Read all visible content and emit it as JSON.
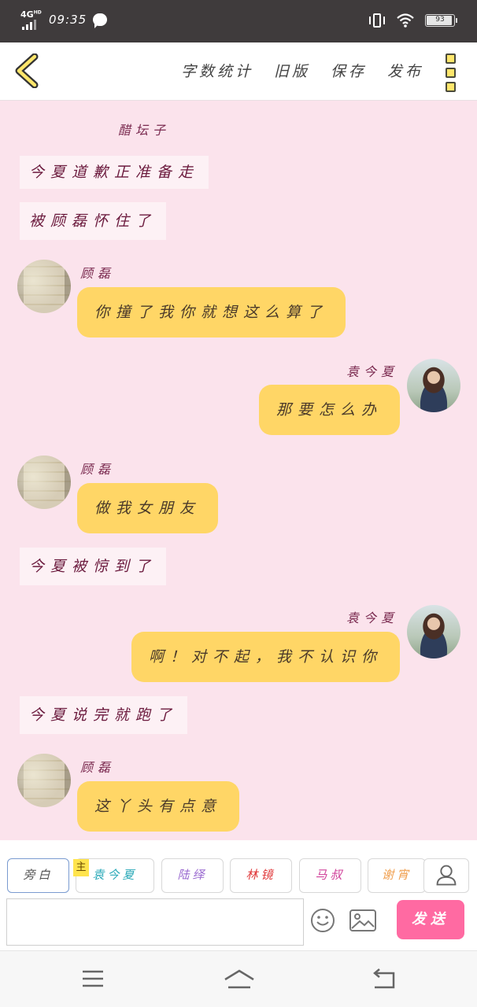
{
  "status": {
    "network": "4G",
    "network_sup": "HD",
    "time": "09:35",
    "battery": "93"
  },
  "header": {
    "menu": [
      "字数统计",
      "旧版",
      "保存",
      "发布"
    ]
  },
  "chat": {
    "author": "醋坛子",
    "messages": [
      {
        "type": "narration",
        "text": "今夏道歉正准备走"
      },
      {
        "type": "narration",
        "text": "被顾磊怀住了"
      },
      {
        "type": "left",
        "name": "顾磊",
        "text": "你撞了我你就想这么算了"
      },
      {
        "type": "right",
        "name": "袁今夏",
        "text": "那要怎么办"
      },
      {
        "type": "left",
        "name": "顾磊",
        "text": "做我女朋友"
      },
      {
        "type": "narration",
        "text": "今夏被惊到了"
      },
      {
        "type": "right",
        "name": "袁今夏",
        "text": "啊！对不起，我不认识你"
      },
      {
        "type": "narration",
        "text": "今夏说完就跑了"
      },
      {
        "type": "left",
        "name": "顾磊",
        "text": "这丫头有点意"
      }
    ]
  },
  "characters": {
    "main_tag": "主",
    "items": [
      {
        "label": "旁白",
        "color": "#555555"
      },
      {
        "label": "袁今夏",
        "color": "#2aa9b8"
      },
      {
        "label": "陆绎",
        "color": "#9a6ad0"
      },
      {
        "label": "林镜",
        "color": "#e0383a"
      },
      {
        "label": "马叔",
        "color": "#d0409a"
      },
      {
        "label": "谢宵",
        "color": "#f0a050"
      }
    ]
  },
  "input": {
    "value": "",
    "send_label": "发送"
  }
}
